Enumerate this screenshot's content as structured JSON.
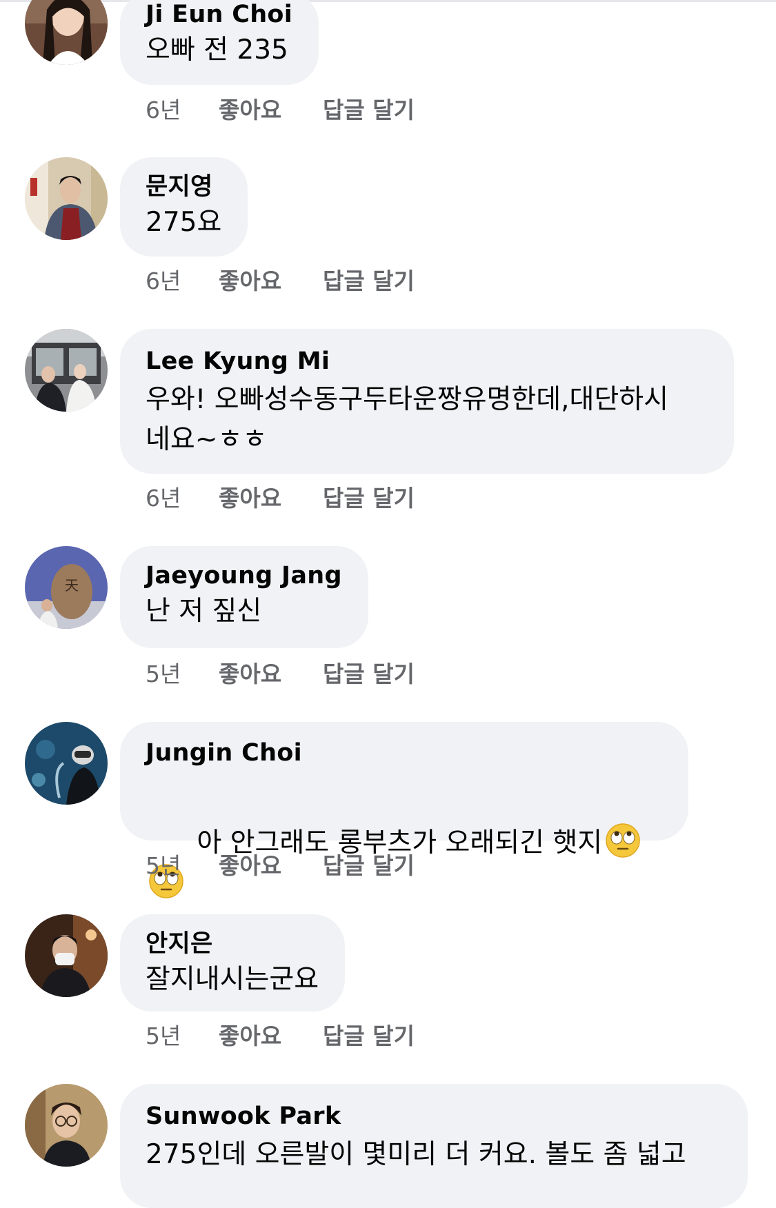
{
  "colors": {
    "bubble": "#f0f2f5",
    "meta_text": "#65676b",
    "text": "#050505"
  },
  "comments": [
    {
      "author": "Ji Eun Choi",
      "text": "오빠 전 235",
      "time": "6년",
      "like_label": "좋아요",
      "reply_label": "답글 달기"
    },
    {
      "author": "문지영",
      "text": "275요",
      "time": "6년",
      "like_label": "좋아요",
      "reply_label": "답글 달기"
    },
    {
      "author": "Lee Kyung Mi",
      "text_line1": "우와! 오빠성수동구두타운짱유명한데,대단하시",
      "text_line2": "네요~ㅎㅎ",
      "time": "6년",
      "like_label": "좋아요",
      "reply_label": "답글 달기"
    },
    {
      "author": "Jaeyoung Jang",
      "text": "난 저 짚신",
      "time": "5년",
      "like_label": "좋아요",
      "reply_label": "답글 달기"
    },
    {
      "author": "Jungin Choi",
      "text": "아 안그래도 롱부츠가 오래되긴 햇지",
      "emoji": "face-with-rolling-eyes-icon",
      "time": "5년",
      "like_label": "좋아요",
      "reply_label": "답글 달기"
    },
    {
      "author": "안지은",
      "text": "잘지내시는군요",
      "time": "5년",
      "like_label": "좋아요",
      "reply_label": "답글 달기"
    },
    {
      "author": "Sunwook Park",
      "text": "275인데 오른발이 몇미리 더 커요. 볼도 좀 넓고"
    }
  ]
}
